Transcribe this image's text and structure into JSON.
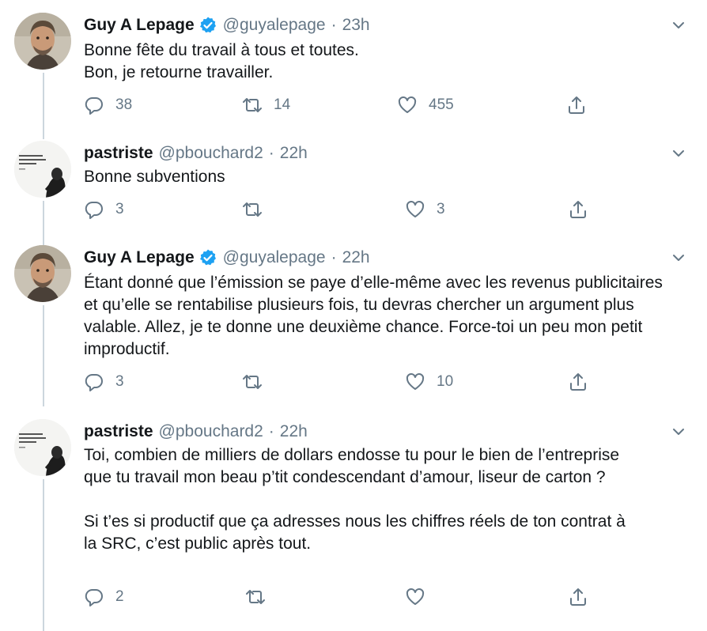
{
  "tweets": [
    {
      "author": "Guy A Lepage",
      "handle": "@guyalepage",
      "separator": "·",
      "time": "23h",
      "verified": true,
      "avatar": "guy-avatar",
      "paragraphs": [
        "Bonne fête du travail à tous et toutes.\nBon, je retourne travailler."
      ],
      "reply_count": "38",
      "retweet_count": "14",
      "like_count": "455"
    },
    {
      "author": "pastriste",
      "handle": "@pbouchard2",
      "separator": "·",
      "time": "22h",
      "verified": false,
      "avatar": "pastriste-avatar",
      "paragraphs": [
        "Bonne subventions"
      ],
      "reply_count": "3",
      "retweet_count": "",
      "like_count": "3"
    },
    {
      "author": "Guy A Lepage",
      "handle": "@guyalepage",
      "separator": "·",
      "time": "22h",
      "verified": true,
      "avatar": "guy-avatar",
      "paragraphs": [
        "Étant donné que l’émission se paye d’elle-même avec les revenus publicitaires et qu’elle se rentabilise plusieurs fois, tu devras chercher un argument plus valable. Allez, je te donne une deuxième chance. Force-toi un peu mon petit improductif."
      ],
      "reply_count": "3",
      "retweet_count": "",
      "like_count": "10"
    },
    {
      "author": "pastriste",
      "handle": "@pbouchard2",
      "separator": "·",
      "time": "22h",
      "verified": false,
      "avatar": "pastriste-avatar",
      "paragraphs": [
        "Toi, combien de milliers de dollars endosse tu pour le bien de l’entreprise  que tu travail mon beau p’tit condescendant d’amour, liseur de carton ?",
        "Si t’es si productif que ça adresses nous les chiffres réels de ton contrat à la SRC, c’est public après tout."
      ],
      "reply_count": "2",
      "retweet_count": "",
      "like_count": ""
    }
  ],
  "colors": {
    "text": "#14171a",
    "muted": "#657786",
    "verified": "#1da1f2",
    "thread_line": "#ccd6dd"
  }
}
